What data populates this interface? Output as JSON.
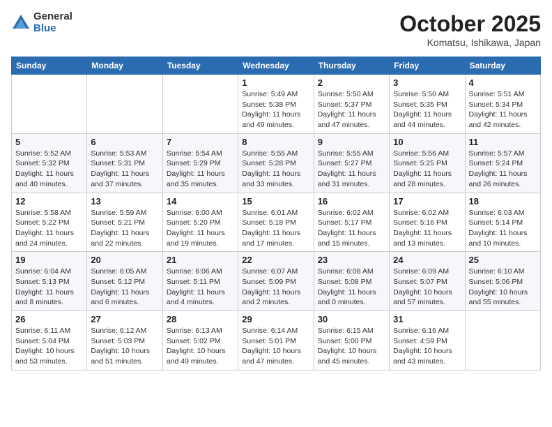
{
  "header": {
    "logo_general": "General",
    "logo_blue": "Blue",
    "month_title": "October 2025",
    "location": "Komatsu, Ishikawa, Japan"
  },
  "weekdays": [
    "Sunday",
    "Monday",
    "Tuesday",
    "Wednesday",
    "Thursday",
    "Friday",
    "Saturday"
  ],
  "weeks": [
    [
      {
        "day": "",
        "info": ""
      },
      {
        "day": "",
        "info": ""
      },
      {
        "day": "",
        "info": ""
      },
      {
        "day": "1",
        "info": "Sunrise: 5:49 AM\nSunset: 5:38 PM\nDaylight: 11 hours\nand 49 minutes."
      },
      {
        "day": "2",
        "info": "Sunrise: 5:50 AM\nSunset: 5:37 PM\nDaylight: 11 hours\nand 47 minutes."
      },
      {
        "day": "3",
        "info": "Sunrise: 5:50 AM\nSunset: 5:35 PM\nDaylight: 11 hours\nand 44 minutes."
      },
      {
        "day": "4",
        "info": "Sunrise: 5:51 AM\nSunset: 5:34 PM\nDaylight: 11 hours\nand 42 minutes."
      }
    ],
    [
      {
        "day": "5",
        "info": "Sunrise: 5:52 AM\nSunset: 5:32 PM\nDaylight: 11 hours\nand 40 minutes."
      },
      {
        "day": "6",
        "info": "Sunrise: 5:53 AM\nSunset: 5:31 PM\nDaylight: 11 hours\nand 37 minutes."
      },
      {
        "day": "7",
        "info": "Sunrise: 5:54 AM\nSunset: 5:29 PM\nDaylight: 11 hours\nand 35 minutes."
      },
      {
        "day": "8",
        "info": "Sunrise: 5:55 AM\nSunset: 5:28 PM\nDaylight: 11 hours\nand 33 minutes."
      },
      {
        "day": "9",
        "info": "Sunrise: 5:55 AM\nSunset: 5:27 PM\nDaylight: 11 hours\nand 31 minutes."
      },
      {
        "day": "10",
        "info": "Sunrise: 5:56 AM\nSunset: 5:25 PM\nDaylight: 11 hours\nand 28 minutes."
      },
      {
        "day": "11",
        "info": "Sunrise: 5:57 AM\nSunset: 5:24 PM\nDaylight: 11 hours\nand 26 minutes."
      }
    ],
    [
      {
        "day": "12",
        "info": "Sunrise: 5:58 AM\nSunset: 5:22 PM\nDaylight: 11 hours\nand 24 minutes."
      },
      {
        "day": "13",
        "info": "Sunrise: 5:59 AM\nSunset: 5:21 PM\nDaylight: 11 hours\nand 22 minutes."
      },
      {
        "day": "14",
        "info": "Sunrise: 6:00 AM\nSunset: 5:20 PM\nDaylight: 11 hours\nand 19 minutes."
      },
      {
        "day": "15",
        "info": "Sunrise: 6:01 AM\nSunset: 5:18 PM\nDaylight: 11 hours\nand 17 minutes."
      },
      {
        "day": "16",
        "info": "Sunrise: 6:02 AM\nSunset: 5:17 PM\nDaylight: 11 hours\nand 15 minutes."
      },
      {
        "day": "17",
        "info": "Sunrise: 6:02 AM\nSunset: 5:16 PM\nDaylight: 11 hours\nand 13 minutes."
      },
      {
        "day": "18",
        "info": "Sunrise: 6:03 AM\nSunset: 5:14 PM\nDaylight: 11 hours\nand 10 minutes."
      }
    ],
    [
      {
        "day": "19",
        "info": "Sunrise: 6:04 AM\nSunset: 5:13 PM\nDaylight: 11 hours\nand 8 minutes."
      },
      {
        "day": "20",
        "info": "Sunrise: 6:05 AM\nSunset: 5:12 PM\nDaylight: 11 hours\nand 6 minutes."
      },
      {
        "day": "21",
        "info": "Sunrise: 6:06 AM\nSunset: 5:11 PM\nDaylight: 11 hours\nand 4 minutes."
      },
      {
        "day": "22",
        "info": "Sunrise: 6:07 AM\nSunset: 5:09 PM\nDaylight: 11 hours\nand 2 minutes."
      },
      {
        "day": "23",
        "info": "Sunrise: 6:08 AM\nSunset: 5:08 PM\nDaylight: 11 hours\nand 0 minutes."
      },
      {
        "day": "24",
        "info": "Sunrise: 6:09 AM\nSunset: 5:07 PM\nDaylight: 10 hours\nand 57 minutes."
      },
      {
        "day": "25",
        "info": "Sunrise: 6:10 AM\nSunset: 5:06 PM\nDaylight: 10 hours\nand 55 minutes."
      }
    ],
    [
      {
        "day": "26",
        "info": "Sunrise: 6:11 AM\nSunset: 5:04 PM\nDaylight: 10 hours\nand 53 minutes."
      },
      {
        "day": "27",
        "info": "Sunrise: 6:12 AM\nSunset: 5:03 PM\nDaylight: 10 hours\nand 51 minutes."
      },
      {
        "day": "28",
        "info": "Sunrise: 6:13 AM\nSunset: 5:02 PM\nDaylight: 10 hours\nand 49 minutes."
      },
      {
        "day": "29",
        "info": "Sunrise: 6:14 AM\nSunset: 5:01 PM\nDaylight: 10 hours\nand 47 minutes."
      },
      {
        "day": "30",
        "info": "Sunrise: 6:15 AM\nSunset: 5:00 PM\nDaylight: 10 hours\nand 45 minutes."
      },
      {
        "day": "31",
        "info": "Sunrise: 6:16 AM\nSunset: 4:59 PM\nDaylight: 10 hours\nand 43 minutes."
      },
      {
        "day": "",
        "info": ""
      }
    ]
  ]
}
